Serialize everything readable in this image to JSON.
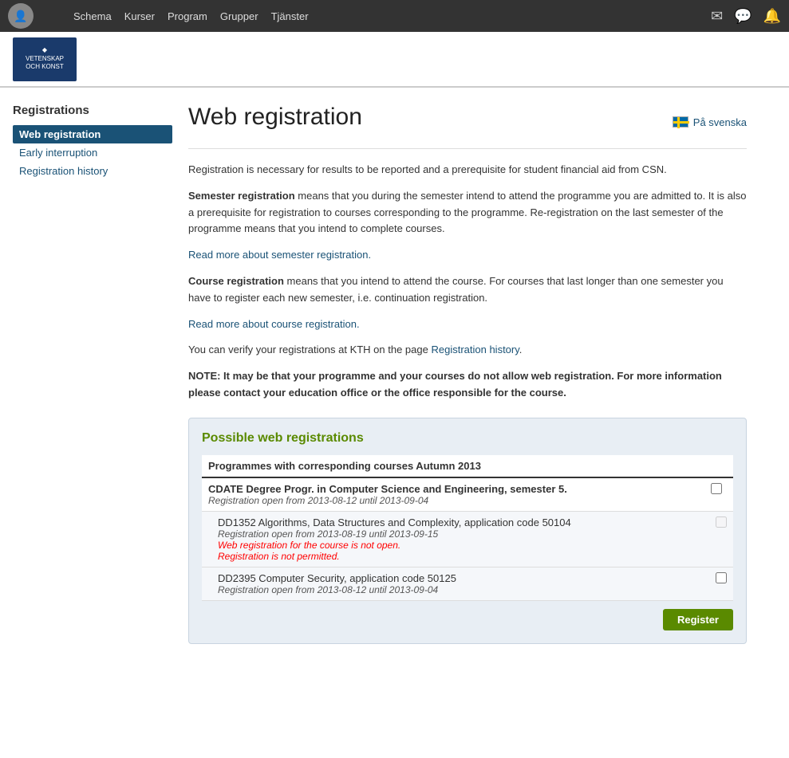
{
  "topnav": {
    "user_name": "",
    "nav_links": [
      "Schema",
      "Kurser",
      "Program",
      "Grupper",
      "Tjänster"
    ],
    "icons": [
      "mail-icon",
      "chat-icon",
      "bell-icon"
    ]
  },
  "logo": {
    "line1": "VETENSKAP",
    "line2": "OCH KONST"
  },
  "sidebar": {
    "title": "Registrations",
    "items": [
      {
        "label": "Web registration",
        "active": true
      },
      {
        "label": "Early interruption",
        "active": false
      },
      {
        "label": "Registration history",
        "active": false
      }
    ]
  },
  "content": {
    "title": "Web registration",
    "lang_switch": "På svenska",
    "intro": "Registration is necessary for results to be reported and a prerequisite for student financial aid from CSN.",
    "semester_bold": "Semester registration",
    "semester_text": " means that you during the semester intend to attend the programme you are admitted to. It is also a prerequisite for registration to courses corresponding to the programme. Re-registration on the last semester of the programme means that you intend to complete courses.",
    "semester_link": "Read more about semester registration.",
    "course_bold": "Course registration",
    "course_text": " means that you intend to attend the course. For courses that last longer than one semester you have to register each new semester, i.e. continuation registration.",
    "course_link": "Read more about course registration.",
    "verify_text": "You can verify your registrations at KTH on the page ",
    "verify_link": "Registration history",
    "verify_end": ".",
    "note": "NOTE: It may be that your programme and your courses do not allow web registration. For more information please contact your education office or the office responsible for the course.",
    "reg_box": {
      "title": "Possible web registrations",
      "table_header": "Programmes with corresponding courses Autumn 2013",
      "programme": {
        "name": "CDATE Degree Progr. in Computer Science and Engineering, semester 5.",
        "dates": "Registration open from 2013-08-12 until 2013-09-04"
      },
      "courses": [
        {
          "name": "DD1352 Algorithms, Data Structures and Complexity, application code 50104",
          "dates": "Registration open from 2013-08-19 until 2013-09-15",
          "error1": "Web registration for the course is not open.",
          "error2": "Registration is not permitted."
        },
        {
          "name": "DD2395 Computer Security, application code 50125",
          "dates": "Registration open from 2013-08-12 until 2013-09-04",
          "error1": "",
          "error2": ""
        }
      ],
      "register_btn": "Register"
    }
  }
}
